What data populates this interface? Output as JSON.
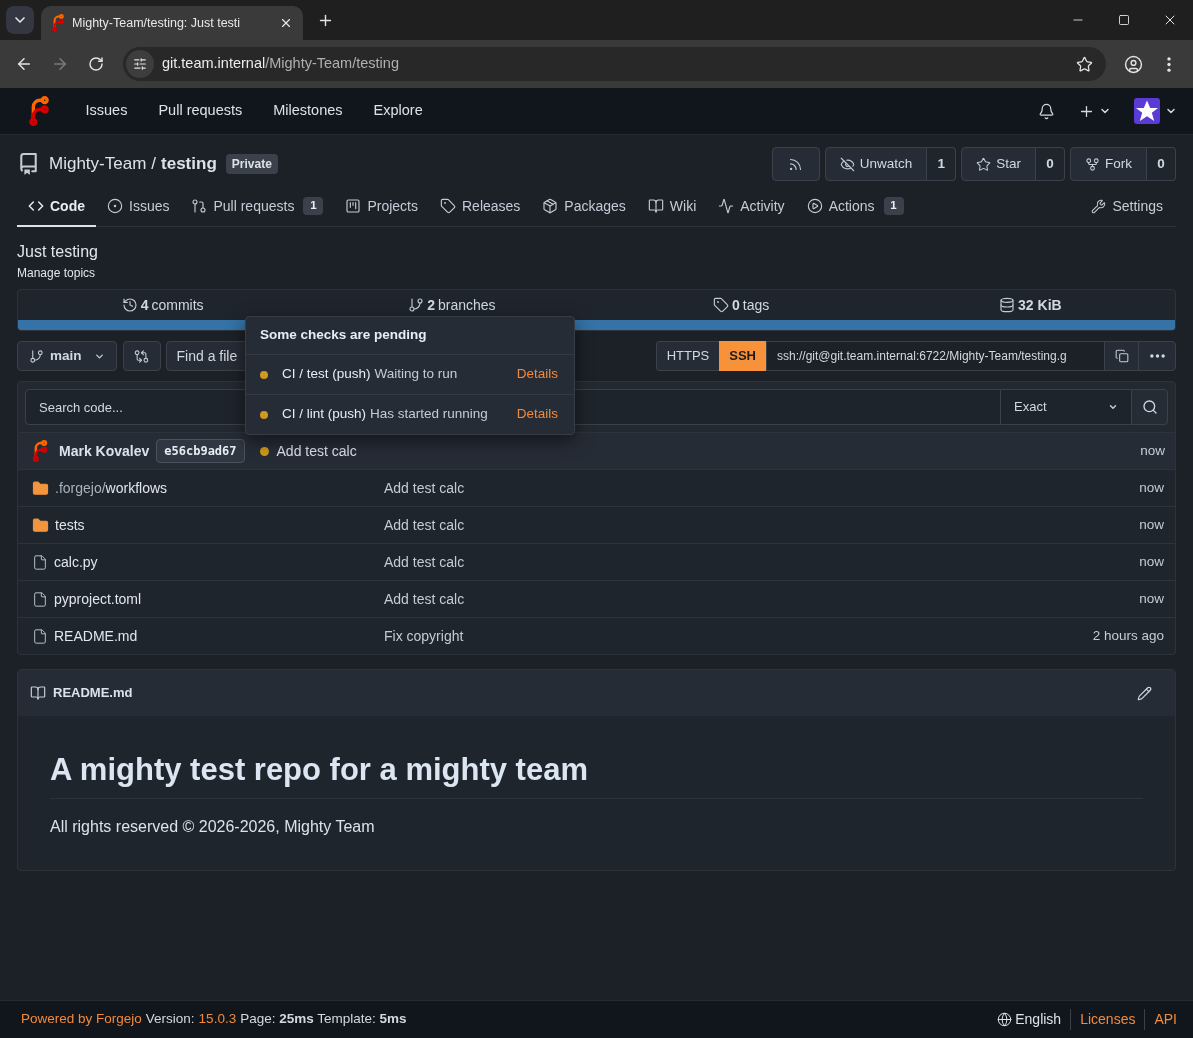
{
  "browser": {
    "tab_title": "Mighty-Team/testing: Just testi",
    "back": {
      "disabled": false
    },
    "forward": {
      "disabled": true
    },
    "url_host": "git.team.internal",
    "url_path": "/Mighty-Team/testing"
  },
  "navbar": {
    "items": [
      "Issues",
      "Pull requests",
      "Milestones",
      "Explore"
    ]
  },
  "repo": {
    "owner": "Mighty-Team",
    "separator": "/",
    "name": "testing",
    "visibility": "Private",
    "buttons": [
      {
        "label": "Unwatch",
        "count": "1"
      },
      {
        "label": "Star",
        "count": "0"
      },
      {
        "label": "Fork",
        "count": "0"
      }
    ]
  },
  "tabs": [
    {
      "label": "Code",
      "selected": true
    },
    {
      "label": "Issues",
      "selected": false
    },
    {
      "label": "Pull requests",
      "selected": false,
      "count": "1"
    },
    {
      "label": "Projects",
      "selected": false
    },
    {
      "label": "Releases",
      "selected": false
    },
    {
      "label": "Packages",
      "selected": false
    },
    {
      "label": "Wiki",
      "selected": false
    },
    {
      "label": "Activity",
      "selected": false
    },
    {
      "label": "Actions",
      "selected": false,
      "count": "1"
    }
  ],
  "settings_tab": {
    "label": "Settings",
    "selected": false
  },
  "description": "Just testing",
  "manage_topics": "Manage topics",
  "stats": [
    {
      "value": "4",
      "label": "commits"
    },
    {
      "value": "2",
      "label": "branches"
    },
    {
      "value": "0",
      "label": "tags"
    },
    {
      "value": "32 KiB"
    }
  ],
  "branch": "main",
  "find_file": "Find a file",
  "clone": {
    "protocols": [
      {
        "label": "HTTPS",
        "selected": false
      },
      {
        "label": "SSH",
        "selected": true
      }
    ],
    "url": "ssh://git@git.team.internal:6722/Mighty-Team/testing.g"
  },
  "search": {
    "placeholder": "Search code...",
    "mode": "Exact"
  },
  "checks_popup": {
    "title": "Some checks are pending",
    "checks": [
      {
        "name": "CI / test (push)",
        "status": "Waiting to run",
        "pending": true,
        "link": "Details"
      },
      {
        "name": "CI / lint (push)",
        "status": "Has started running",
        "pending": true,
        "link": "Details"
      }
    ]
  },
  "last_commit": {
    "author": "Mark Kovalev",
    "sha": "e56cb9ad67",
    "pending": true,
    "message": "Add test calc",
    "time": "now"
  },
  "files": [
    {
      "kind": "dir",
      "parent": ".forgejo/",
      "name": "workflows",
      "message": "Add test calc",
      "time": "now"
    },
    {
      "kind": "dir",
      "name": "tests",
      "message": "Add test calc",
      "time": "now"
    },
    {
      "kind": "file",
      "name": "calc.py",
      "message": "Add test calc",
      "time": "now"
    },
    {
      "kind": "file",
      "name": "pyproject.toml",
      "message": "Add test calc",
      "time": "now"
    },
    {
      "kind": "file",
      "name": "README.md",
      "message": "Fix copyright",
      "time": "2 hours ago"
    }
  ],
  "readme": {
    "filename": "README.md",
    "heading": "A mighty test repo for a mighty team",
    "text": "All rights reserved © 2026-2026, Mighty Team"
  },
  "footer": {
    "powered_by": "Powered by Forgejo",
    "version_label": "Version:",
    "version": "15.0.3",
    "timing": "Page: **25ms** Template: **5ms**",
    "language": "English",
    "links": [
      "Licenses",
      "API"
    ]
  }
}
